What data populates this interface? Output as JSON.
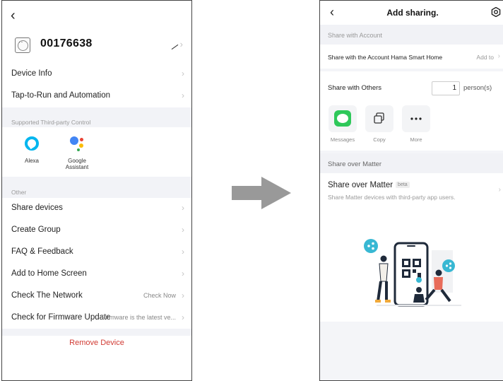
{
  "left_screen": {
    "device_name": "00176638",
    "rows_top": [
      {
        "label": "Device Info"
      },
      {
        "label": "Tap-to-Run and Automation"
      }
    ],
    "third_party_header": "Supported Third-party Control",
    "third_party": [
      {
        "name": "Alexa",
        "icon": "alexa-icon"
      },
      {
        "name": "Google\nAssistant",
        "icon": "google-assistant-icon"
      }
    ],
    "other_header": "Other",
    "rows_other": [
      {
        "label": "Share devices",
        "value": ""
      },
      {
        "label": "Create Group",
        "value": ""
      },
      {
        "label": "FAQ & Feedback",
        "value": ""
      },
      {
        "label": "Add to Home Screen",
        "value": ""
      },
      {
        "label": "Check The Network",
        "value": "Check Now"
      },
      {
        "label": "Check for Firmware Update",
        "value": "Firmware is the latest ve..."
      }
    ],
    "remove_label": "Remove Device"
  },
  "right_screen": {
    "title": "Add sharing.",
    "share_account_header": "Share with Account",
    "share_account_label": "Share with the Account Hama Smart Home",
    "share_account_action": "Add to",
    "share_others_label": "Share with Others",
    "person_count": "1",
    "person_unit": "person(s)",
    "share_options": [
      {
        "label": "Messages",
        "icon": "messages-icon"
      },
      {
        "label": "Copy",
        "icon": "copy-icon"
      },
      {
        "label": "More",
        "icon": "more-icon"
      }
    ],
    "matter_header": "Share over Matter",
    "matter_title": "Share over Matter",
    "matter_badge": "beta",
    "matter_desc": "Share Matter devices with third-party app users."
  },
  "colors": {
    "remove": "#d13b34",
    "alexa": "#00b6ef",
    "messages_green": "#2fc85a",
    "arrow_gray": "#999999",
    "illustration_teal": "#38b8d3"
  }
}
